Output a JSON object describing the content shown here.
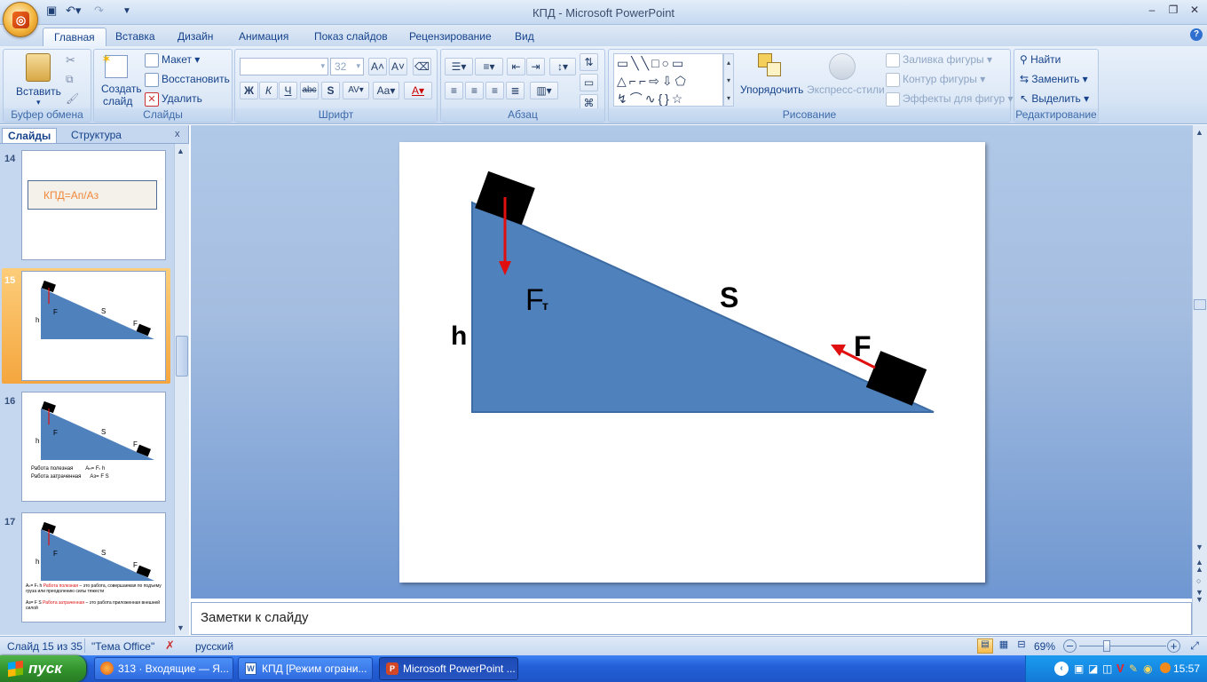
{
  "window": {
    "title": "КПД  -  Microsoft PowerPoint"
  },
  "tabs": [
    {
      "label": "Главная",
      "active": true
    },
    {
      "label": "Вставка"
    },
    {
      "label": "Дизайн"
    },
    {
      "label": "Анимация"
    },
    {
      "label": "Показ слайдов"
    },
    {
      "label": "Рецензирование"
    },
    {
      "label": "Вид"
    }
  ],
  "ribbon": {
    "clipboard": {
      "paste": "Вставить",
      "label": "Буфер обмена"
    },
    "slides": {
      "create": "Создать",
      "create2": "слайд",
      "layout": "Макет",
      "reset": "Восстановить",
      "delete": "Удалить",
      "label": "Слайды"
    },
    "font": {
      "size": "32",
      "label": "Шрифт"
    },
    "paragraph": {
      "label": "Абзац"
    },
    "drawing": {
      "arrange": "Упорядочить",
      "quick_styles": "Экспресс-стили",
      "fill": "Заливка фигуры",
      "outline": "Контур фигуры",
      "effects": "Эффекты для фигур",
      "label": "Рисование"
    },
    "editing": {
      "find": "Найти",
      "replace": "Заменить",
      "select": "Выделить",
      "label": "Редактирование"
    }
  },
  "left_pane": {
    "tab_slides": "Слайды",
    "tab_outline": "Структура",
    "close": "x",
    "thumbs": [
      {
        "num": "14",
        "text": "КПД=Ап/Аз"
      },
      {
        "num": "15"
      },
      {
        "num": "16",
        "line1a": "Работа полезная",
        "line1b": "Аₙ= Fₜ h",
        "line2a": "Работа затраченная",
        "line2b": "Аз= F S"
      },
      {
        "num": "17",
        "line1": "Аₙ= Fₜ h",
        "line1r": "Работа полезная",
        "line1t": "– это работа, совершаемая по подъему груза или преодолению силы тяжести",
        "line2": "Аз= F S",
        "line2r": "Работа затраченная",
        "line2t": "– это работа приложенная внешней силой"
      }
    ]
  },
  "slide": {
    "h": "h",
    "ft": "F",
    "ft_sub": "т",
    "s": "S",
    "f": "F"
  },
  "notes": {
    "placeholder": "Заметки к слайду"
  },
  "status": {
    "slide": "Слайд 15 из 35",
    "theme": "\"Тема Office\"",
    "lang": "русский",
    "zoom": "69%"
  },
  "taskbar": {
    "start": "пуск",
    "tasks": [
      "313 · Входящие — Я...",
      "КПД [Режим ограни...",
      "Microsoft PowerPoint ..."
    ],
    "lang": "RU",
    "time": "15:57"
  },
  "colors": {
    "slide_fill": "#4f81bd",
    "arrow": "#e01010",
    "accent": "#f5a63e"
  }
}
